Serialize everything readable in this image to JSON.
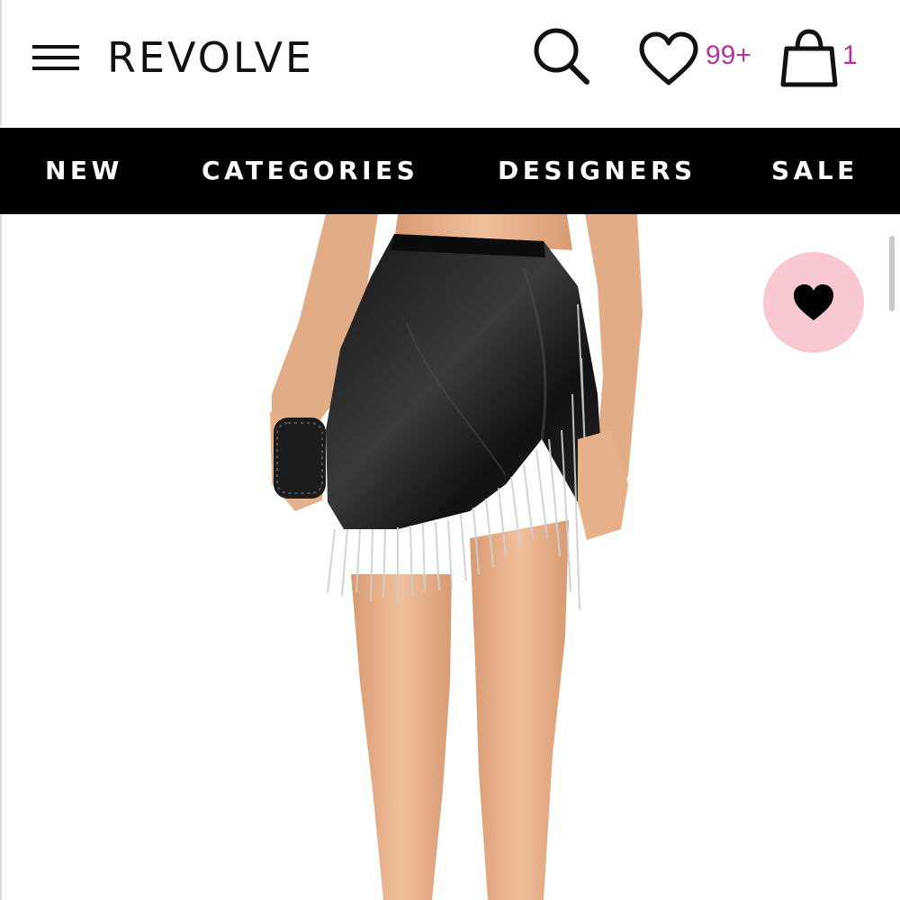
{
  "header": {
    "logo": "REVOLVE",
    "wishlist_count": "99+",
    "bag_count": "1",
    "icons": {
      "menu": "menu-icon",
      "search": "search-icon",
      "wishlist": "heart-outline-icon",
      "bag": "shopping-bag-icon"
    },
    "accent_color": "#b3359b"
  },
  "nav": {
    "items": [
      {
        "label": "NEW"
      },
      {
        "label": "CATEGORIES"
      },
      {
        "label": "DESIGNERS"
      },
      {
        "label": "SALE"
      }
    ],
    "background_color": "#000000"
  },
  "product": {
    "image": "product-photo",
    "favorite_icon": "heart-filled-icon",
    "favorite_button_color": "#f9c9d2"
  }
}
